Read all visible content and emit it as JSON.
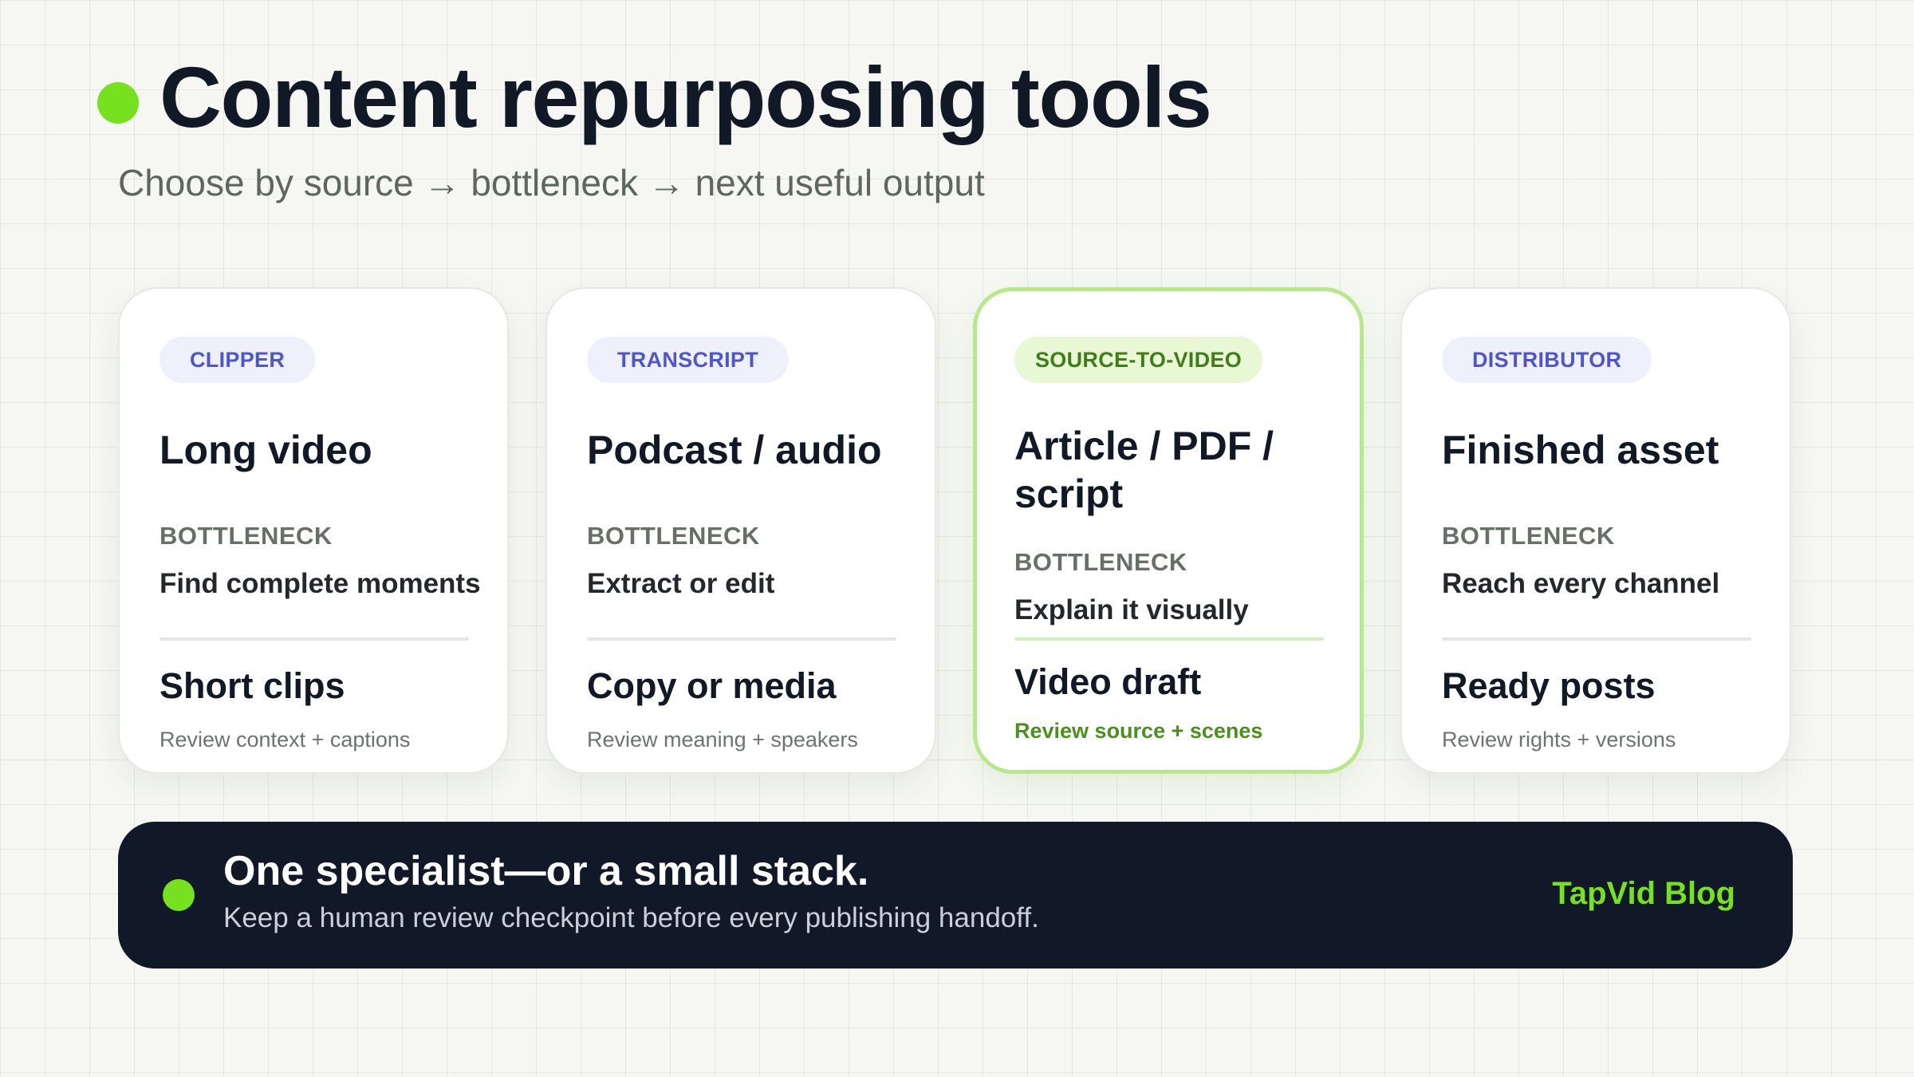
{
  "header": {
    "title": "Content repurposing tools",
    "subtitle": "Choose by source → bottleneck → next useful output"
  },
  "cards": [
    {
      "badge": "CLIPPER",
      "source": "Long video",
      "bottleneck_label": "BOTTLENECK",
      "bottleneck": "Find complete moments",
      "output": "Short clips",
      "review": "Review context + captions"
    },
    {
      "badge": "TRANSCRIPT",
      "source": "Podcast / audio",
      "bottleneck_label": "BOTTLENECK",
      "bottleneck": "Extract or edit",
      "output": "Copy or media",
      "review": "Review meaning + speakers"
    },
    {
      "badge": "SOURCE-TO-VIDEO",
      "source": "Article / PDF / script",
      "bottleneck_label": "BOTTLENECK",
      "bottleneck": "Explain it visually",
      "output": "Video draft",
      "review": "Review source + scenes"
    },
    {
      "badge": "DISTRIBUTOR",
      "source": "Finished asset",
      "bottleneck_label": "BOTTLENECK",
      "bottleneck": "Reach every channel",
      "output": "Ready posts",
      "review": "Review rights + versions"
    }
  ],
  "callout": {
    "heading": "One specialist—or a small stack.",
    "text": "Keep a human review checkpoint before every publishing handoff.",
    "brand": "TapVid Blog"
  },
  "colors": {
    "accent": "#76e11f",
    "dark": "#111827",
    "badge_blue": "#4f56cc",
    "badge_green": "#3f7d1a"
  }
}
